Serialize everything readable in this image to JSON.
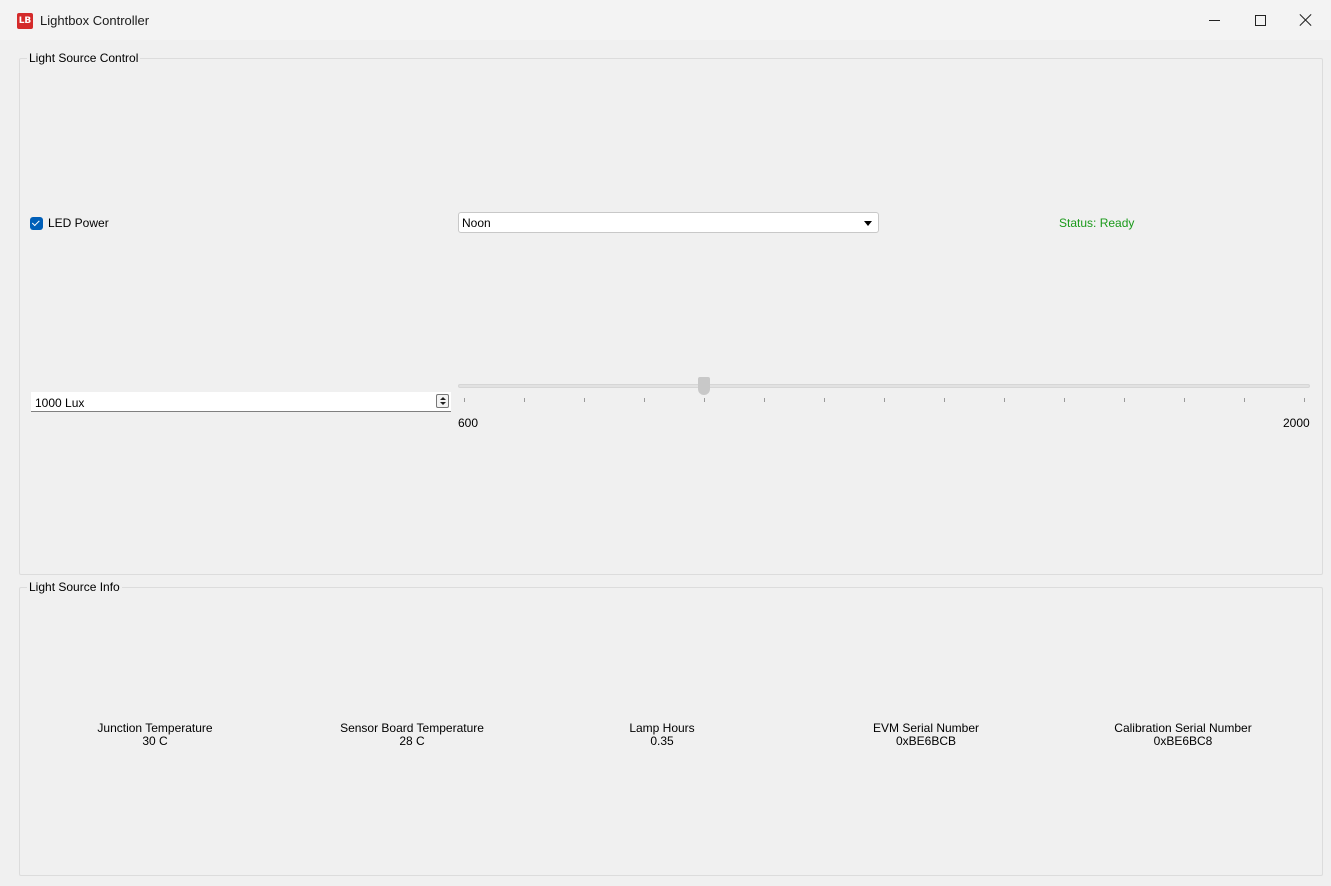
{
  "window": {
    "title": "Lightbox Controller",
    "app_icon_text": "LB"
  },
  "control_group": {
    "title": "Light Source Control",
    "led_power": {
      "label": "LED Power",
      "checked": true
    },
    "mode_select": {
      "value": "Noon"
    },
    "status": {
      "text": "Status: Ready",
      "color": "#1a9a1a"
    },
    "lux_spinbox": {
      "value": "1000 Lux"
    },
    "slider": {
      "min_label": "600",
      "max_label": "2000",
      "min": 600,
      "max": 2000,
      "value": 1000,
      "tick_count": 15
    }
  },
  "info_group": {
    "title": "Light Source Info",
    "items": [
      {
        "label": "Junction Temperature",
        "value": "30 C"
      },
      {
        "label": "Sensor Board Temperature",
        "value": "28 C"
      },
      {
        "label": "Lamp Hours",
        "value": "0.35"
      },
      {
        "label": "EVM Serial Number",
        "value": "0xBE6BCB"
      },
      {
        "label": "Calibration Serial Number",
        "value": "0xBE6BC8"
      }
    ]
  },
  "colors": {
    "accent": "#005fb8",
    "background": "#f0f0f0"
  }
}
